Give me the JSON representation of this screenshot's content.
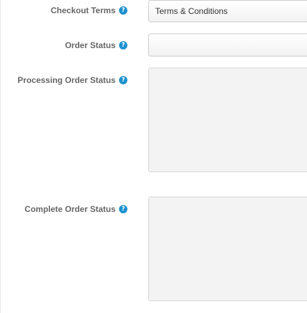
{
  "settings": {
    "checkout_terms": {
      "label": "Checkout Terms",
      "value": "Terms & Conditions",
      "help_icon": "question-icon"
    },
    "order_status": {
      "label": "Order Status",
      "value": "",
      "help_icon": "question-icon"
    },
    "processing_order_status": {
      "label": "Processing Order Status",
      "help_icon": "question-icon"
    },
    "complete_order_status": {
      "label": "Complete Order Status",
      "help_icon": "question-icon"
    }
  },
  "colors": {
    "help_icon": "#1e91cf",
    "label": "#666666",
    "multi_select_bg": "#f3f3f3"
  }
}
